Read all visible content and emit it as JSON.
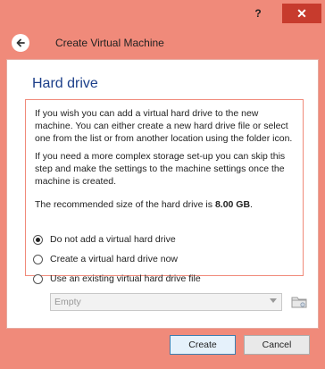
{
  "window": {
    "help_label": "?",
    "close_label": "✕"
  },
  "header": {
    "title": "Create Virtual Machine"
  },
  "content": {
    "title": "Hard drive",
    "para1": "If you wish you can add a virtual hard drive to the new machine. You can either create a new hard drive file or select one from the list or from another location using the folder icon.",
    "para2": "If you need a more complex storage set-up you can skip this step and make the settings to the machine settings once the machine is created.",
    "para3_prefix": "The recommended size of the hard drive is ",
    "para3_size": "8.00 GB",
    "para3_suffix": "."
  },
  "options": [
    {
      "label": "Do not add a virtual hard drive",
      "selected": true
    },
    {
      "label": "Create a virtual hard drive now",
      "selected": false
    },
    {
      "label": "Use an existing virtual hard drive file",
      "selected": false
    }
  ],
  "file_select": {
    "value": "Empty"
  },
  "buttons": {
    "create": "Create",
    "cancel": "Cancel"
  }
}
